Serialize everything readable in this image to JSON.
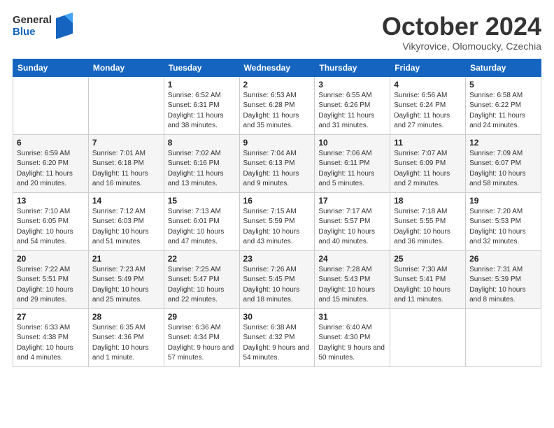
{
  "header": {
    "logo_line1": "General",
    "logo_line2": "Blue",
    "month_title": "October 2024",
    "subtitle": "Vikyrovice, Olomoucky, Czechia"
  },
  "weekdays": [
    "Sunday",
    "Monday",
    "Tuesday",
    "Wednesday",
    "Thursday",
    "Friday",
    "Saturday"
  ],
  "weeks": [
    [
      {
        "day": "",
        "info": ""
      },
      {
        "day": "",
        "info": ""
      },
      {
        "day": "1",
        "info": "Sunrise: 6:52 AM\nSunset: 6:31 PM\nDaylight: 11 hours and 38 minutes."
      },
      {
        "day": "2",
        "info": "Sunrise: 6:53 AM\nSunset: 6:28 PM\nDaylight: 11 hours and 35 minutes."
      },
      {
        "day": "3",
        "info": "Sunrise: 6:55 AM\nSunset: 6:26 PM\nDaylight: 11 hours and 31 minutes."
      },
      {
        "day": "4",
        "info": "Sunrise: 6:56 AM\nSunset: 6:24 PM\nDaylight: 11 hours and 27 minutes."
      },
      {
        "day": "5",
        "info": "Sunrise: 6:58 AM\nSunset: 6:22 PM\nDaylight: 11 hours and 24 minutes."
      }
    ],
    [
      {
        "day": "6",
        "info": "Sunrise: 6:59 AM\nSunset: 6:20 PM\nDaylight: 11 hours and 20 minutes."
      },
      {
        "day": "7",
        "info": "Sunrise: 7:01 AM\nSunset: 6:18 PM\nDaylight: 11 hours and 16 minutes."
      },
      {
        "day": "8",
        "info": "Sunrise: 7:02 AM\nSunset: 6:16 PM\nDaylight: 11 hours and 13 minutes."
      },
      {
        "day": "9",
        "info": "Sunrise: 7:04 AM\nSunset: 6:13 PM\nDaylight: 11 hours and 9 minutes."
      },
      {
        "day": "10",
        "info": "Sunrise: 7:06 AM\nSunset: 6:11 PM\nDaylight: 11 hours and 5 minutes."
      },
      {
        "day": "11",
        "info": "Sunrise: 7:07 AM\nSunset: 6:09 PM\nDaylight: 11 hours and 2 minutes."
      },
      {
        "day": "12",
        "info": "Sunrise: 7:09 AM\nSunset: 6:07 PM\nDaylight: 10 hours and 58 minutes."
      }
    ],
    [
      {
        "day": "13",
        "info": "Sunrise: 7:10 AM\nSunset: 6:05 PM\nDaylight: 10 hours and 54 minutes."
      },
      {
        "day": "14",
        "info": "Sunrise: 7:12 AM\nSunset: 6:03 PM\nDaylight: 10 hours and 51 minutes."
      },
      {
        "day": "15",
        "info": "Sunrise: 7:13 AM\nSunset: 6:01 PM\nDaylight: 10 hours and 47 minutes."
      },
      {
        "day": "16",
        "info": "Sunrise: 7:15 AM\nSunset: 5:59 PM\nDaylight: 10 hours and 43 minutes."
      },
      {
        "day": "17",
        "info": "Sunrise: 7:17 AM\nSunset: 5:57 PM\nDaylight: 10 hours and 40 minutes."
      },
      {
        "day": "18",
        "info": "Sunrise: 7:18 AM\nSunset: 5:55 PM\nDaylight: 10 hours and 36 minutes."
      },
      {
        "day": "19",
        "info": "Sunrise: 7:20 AM\nSunset: 5:53 PM\nDaylight: 10 hours and 32 minutes."
      }
    ],
    [
      {
        "day": "20",
        "info": "Sunrise: 7:22 AM\nSunset: 5:51 PM\nDaylight: 10 hours and 29 minutes."
      },
      {
        "day": "21",
        "info": "Sunrise: 7:23 AM\nSunset: 5:49 PM\nDaylight: 10 hours and 25 minutes."
      },
      {
        "day": "22",
        "info": "Sunrise: 7:25 AM\nSunset: 5:47 PM\nDaylight: 10 hours and 22 minutes."
      },
      {
        "day": "23",
        "info": "Sunrise: 7:26 AM\nSunset: 5:45 PM\nDaylight: 10 hours and 18 minutes."
      },
      {
        "day": "24",
        "info": "Sunrise: 7:28 AM\nSunset: 5:43 PM\nDaylight: 10 hours and 15 minutes."
      },
      {
        "day": "25",
        "info": "Sunrise: 7:30 AM\nSunset: 5:41 PM\nDaylight: 10 hours and 11 minutes."
      },
      {
        "day": "26",
        "info": "Sunrise: 7:31 AM\nSunset: 5:39 PM\nDaylight: 10 hours and 8 minutes."
      }
    ],
    [
      {
        "day": "27",
        "info": "Sunrise: 6:33 AM\nSunset: 4:38 PM\nDaylight: 10 hours and 4 minutes."
      },
      {
        "day": "28",
        "info": "Sunrise: 6:35 AM\nSunset: 4:36 PM\nDaylight: 10 hours and 1 minute."
      },
      {
        "day": "29",
        "info": "Sunrise: 6:36 AM\nSunset: 4:34 PM\nDaylight: 9 hours and 57 minutes."
      },
      {
        "day": "30",
        "info": "Sunrise: 6:38 AM\nSunset: 4:32 PM\nDaylight: 9 hours and 54 minutes."
      },
      {
        "day": "31",
        "info": "Sunrise: 6:40 AM\nSunset: 4:30 PM\nDaylight: 9 hours and 50 minutes."
      },
      {
        "day": "",
        "info": ""
      },
      {
        "day": "",
        "info": ""
      }
    ]
  ]
}
